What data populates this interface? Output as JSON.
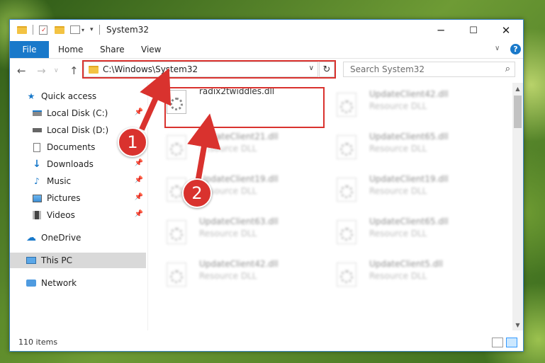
{
  "window": {
    "title": "System32",
    "controls": {
      "minimize": "─",
      "maximize": "☐",
      "close": "✕"
    }
  },
  "ribbon": {
    "tabs": [
      {
        "label": "File"
      },
      {
        "label": "Home"
      },
      {
        "label": "Share"
      },
      {
        "label": "View"
      }
    ]
  },
  "navigation": {
    "address": "C:\\Windows\\System32",
    "search_placeholder": "Search System32"
  },
  "sidebar": {
    "items": [
      {
        "label": "Quick access",
        "icon": "star-icon",
        "pinned": false
      },
      {
        "label": "Local Disk (C:)",
        "icon": "drive-icon",
        "pinned": true
      },
      {
        "label": "Local Disk (D:)",
        "icon": "drive-icon",
        "pinned": false
      },
      {
        "label": "Documents",
        "icon": "document-icon",
        "pinned": true
      },
      {
        "label": "Downloads",
        "icon": "download-icon",
        "pinned": true
      },
      {
        "label": "Music",
        "icon": "music-icon",
        "pinned": true
      },
      {
        "label": "Pictures",
        "icon": "pictures-icon",
        "pinned": true
      },
      {
        "label": "Videos",
        "icon": "video-icon",
        "pinned": true
      },
      {
        "label": "OneDrive",
        "icon": "cloud-icon",
        "pinned": false
      },
      {
        "label": "This PC",
        "icon": "computer-icon",
        "pinned": false,
        "selected": true
      },
      {
        "label": "Network",
        "icon": "network-icon",
        "pinned": false
      }
    ]
  },
  "files": {
    "highlighted": {
      "name": "radix2twiddles.dll"
    },
    "tiles": [
      {
        "name": "UpdateClient42.dll",
        "type": "Resource DLL"
      },
      {
        "name": "UpdateClient21.dll",
        "type": "Resource DLL"
      },
      {
        "name": "UpdateClient65.dll",
        "type": "Resource DLL"
      },
      {
        "name": "UpdateClient19.dll",
        "type": "Resource DLL"
      },
      {
        "name": "UpdateClient19.dll",
        "type": "Resource DLL"
      },
      {
        "name": "UpdateClient63.dll",
        "type": "Resource DLL"
      },
      {
        "name": "UpdateClient65.dll",
        "type": "Resource DLL"
      },
      {
        "name": "UpdateClient42.dll",
        "type": "Resource DLL"
      },
      {
        "name": "UpdateClient5.dll",
        "type": "Resource DLL"
      }
    ]
  },
  "status": {
    "item_count": "110 items"
  },
  "annotations": {
    "step1": "1",
    "step2": "2",
    "accent": "#d9322e"
  }
}
